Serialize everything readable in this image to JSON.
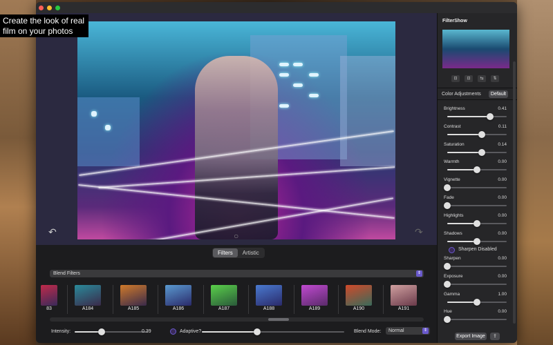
{
  "caption": "Create the look of real film on your photos",
  "window": {
    "lights": [
      "#ff5f57",
      "#febc2e",
      "#28c840"
    ]
  },
  "toolbar": {
    "undo_icon": "↶",
    "redo_icon": "↷",
    "lens_icon": "○"
  },
  "tabs": [
    {
      "label": "Filters",
      "active": true
    },
    {
      "label": "Artistic",
      "active": false
    }
  ],
  "filter_set": {
    "label": "Blend Filters",
    "arrow": "⇕"
  },
  "thumbnails": [
    {
      "label": "83",
      "colors": [
        "#c02a4a",
        "#3a2a5a"
      ]
    },
    {
      "label": "A184",
      "colors": [
        "#2a8a9a",
        "#3a2a4a"
      ]
    },
    {
      "label": "A185",
      "colors": [
        "#d07a2a",
        "#3a2a4a"
      ]
    },
    {
      "label": "A186",
      "colors": [
        "#5a9ad0",
        "#2a2a6a"
      ]
    },
    {
      "label": "A187",
      "colors": [
        "#5ad04a",
        "#2a5a3a"
      ]
    },
    {
      "label": "A188",
      "colors": [
        "#4a7ad0",
        "#2a2a6a"
      ]
    },
    {
      "label": "A189",
      "colors": [
        "#c04ad0",
        "#5a2a6a"
      ]
    },
    {
      "label": "A190",
      "colors": [
        "#d04a2a",
        "#3a6a5a"
      ]
    },
    {
      "label": "A191",
      "colors": [
        "#d0a0a0",
        "#6a3a4a"
      ]
    }
  ],
  "controls": {
    "intensity_label": "Intensity:",
    "intensity_value": "0.39",
    "adaptive_label": "Adaptive?",
    "blend_mode_label": "Blend Mode:",
    "blend_mode_value": "Normal"
  },
  "sidebar": {
    "title": "FilterShow",
    "flip_icons": [
      "⊡",
      "⊡",
      "⇆",
      "⇅"
    ],
    "color_adjustments_label": "Color Adjustments",
    "default_label": "Default",
    "adjustments": [
      {
        "name": "Brightness",
        "value": "0.41",
        "pos": 0.72
      },
      {
        "name": "Contrast",
        "value": "0.11",
        "pos": 0.58
      },
      {
        "name": "Saturation",
        "value": "0.14",
        "pos": 0.58
      },
      {
        "name": "Warmth",
        "value": "0.00",
        "pos": 0.5
      },
      {
        "name": "Vignette",
        "value": "0.00",
        "pos": 0.0
      },
      {
        "name": "Fade",
        "value": "0.00",
        "pos": 0.0
      },
      {
        "name": "Highlights",
        "value": "0.00",
        "pos": 0.5
      },
      {
        "name": "Shadows",
        "value": "0.00",
        "pos": 0.5
      }
    ],
    "sharpen_label": "Sharpen Disabled",
    "adjustments2": [
      {
        "name": "Sharpen",
        "value": "0.00",
        "pos": 0.0
      },
      {
        "name": "Exposure",
        "value": "0.00",
        "pos": 0.0
      },
      {
        "name": "Gamma",
        "value": "1.00",
        "pos": 0.5
      },
      {
        "name": "Hue",
        "value": "0.00",
        "pos": 0.0
      }
    ],
    "export_label": "Export Image",
    "share_icon": "⇪"
  }
}
